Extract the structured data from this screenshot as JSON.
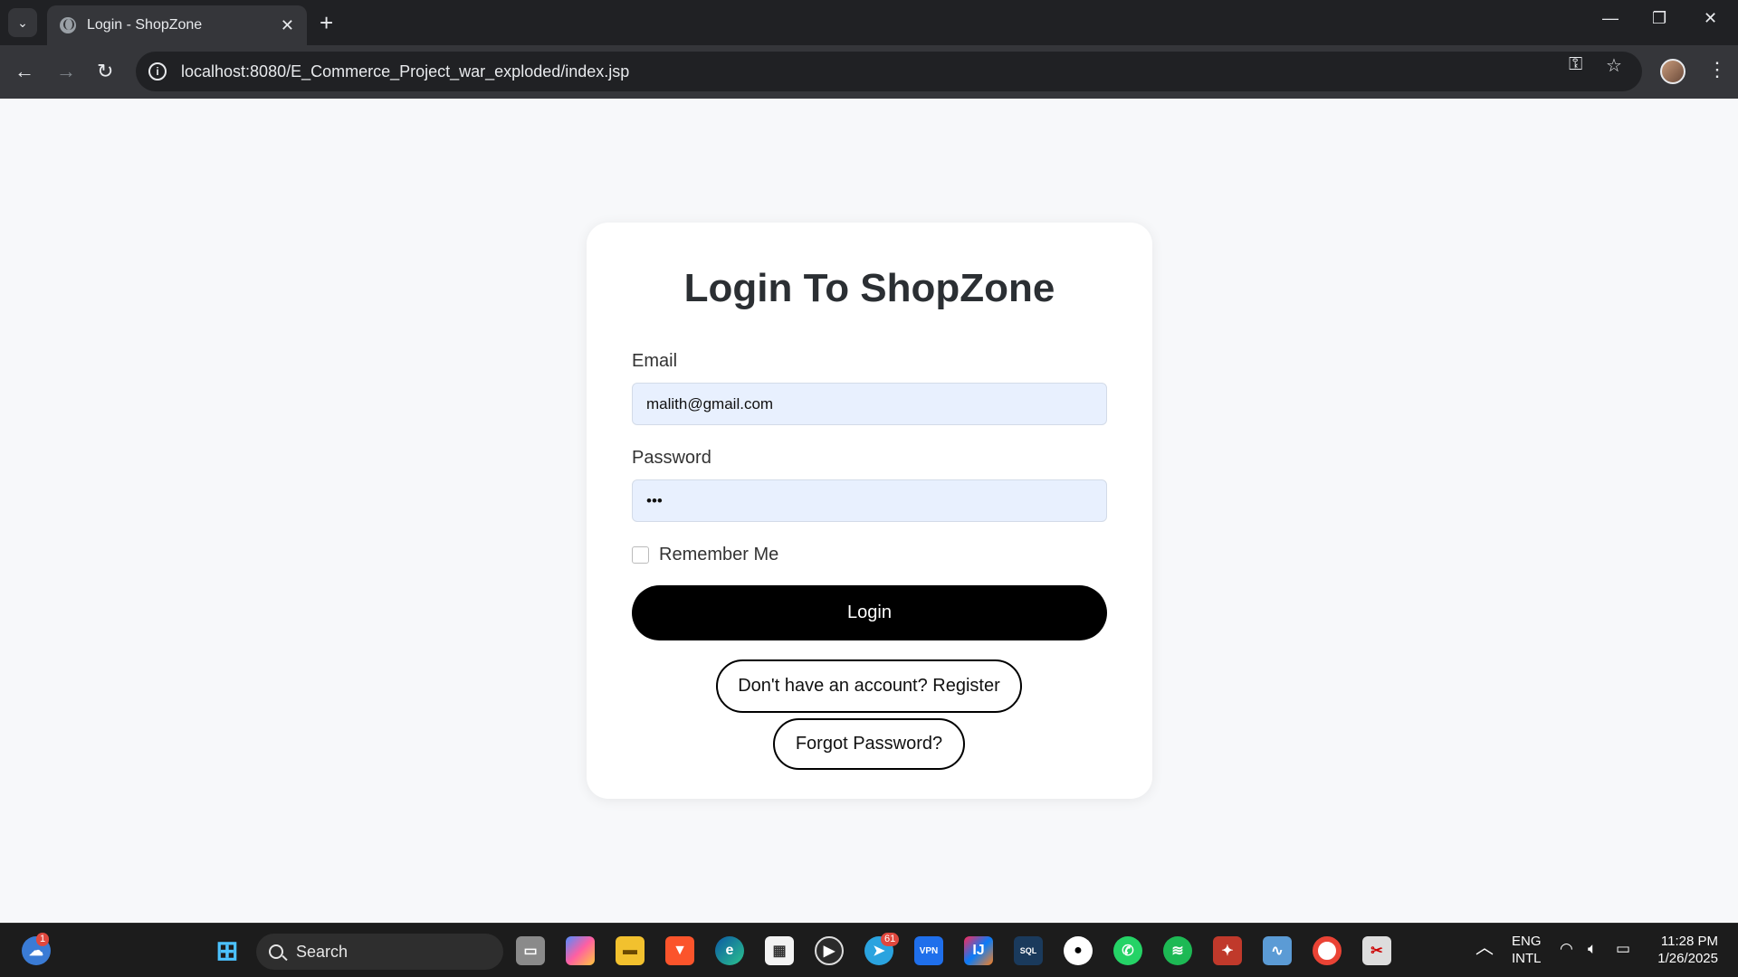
{
  "browser": {
    "tab_title": "Login - ShopZone",
    "url": "localhost:8080/E_Commerce_Project_war_exploded/index.jsp",
    "new_tab_symbol": "+",
    "close_symbol": "✕"
  },
  "login": {
    "heading": "Login To ShopZone",
    "email_label": "Email",
    "email_value": "malith@gmail.com",
    "password_label": "Password",
    "password_value": "•••",
    "remember_label": "Remember Me",
    "login_button": "Login",
    "register_link": "Don't have an account? Register",
    "forgot_link": "Forgot Password?"
  },
  "taskbar": {
    "search_label": "Search",
    "weather_badge": "1",
    "telegram_badge": "61",
    "language": "ENG",
    "layout": "INTL",
    "time": "11:28 PM",
    "date": "1/26/2025"
  },
  "colors": {
    "page_bg": "#f7f8fa",
    "accent_button": "#000000",
    "autofill_field": "#e8f0fe"
  }
}
